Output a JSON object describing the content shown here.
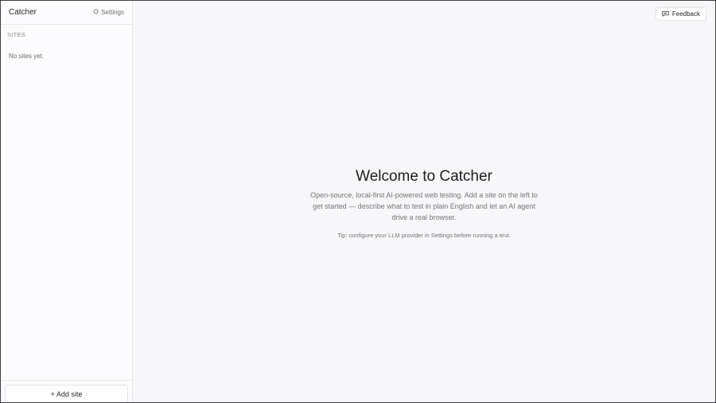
{
  "sidebar": {
    "app_name": "Catcher",
    "settings_label": "Settings",
    "section_title": "SITES",
    "empty_text": "No sites yet.",
    "add_site_label": "+ Add site"
  },
  "header": {
    "feedback_label": "Feedback"
  },
  "welcome": {
    "title": "Welcome to Catcher",
    "description": "Open-source, local-first AI-powered web testing. Add a site on the left to get started — describe what to test in plain English and let an AI agent drive a real browser.",
    "tip": "Tip: configure your LLM provider in Settings before running a test."
  },
  "icons": {
    "settings": "gear-icon",
    "feedback": "chat-bubble-icon"
  }
}
